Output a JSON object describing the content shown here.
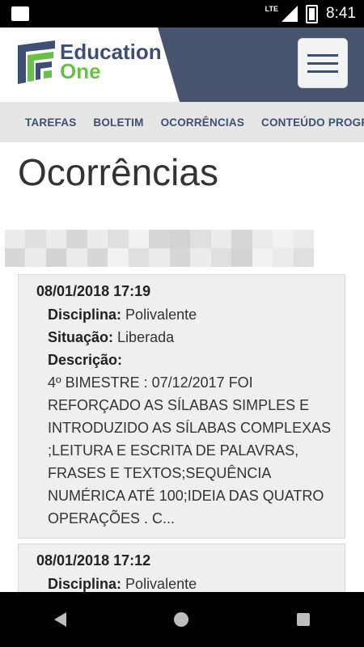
{
  "status_bar": {
    "network": "LTE",
    "time": "8:41"
  },
  "header": {
    "logo_line1": "Education",
    "logo_line2": "One"
  },
  "nav": {
    "tabs": [
      "TAREFAS",
      "BOLETIM",
      "OCORRÊNCIAS",
      "CONTEÚDO PROGR"
    ]
  },
  "page": {
    "title": "Ocorrências"
  },
  "entries": [
    {
      "datetime": "08/01/2018 17:19",
      "disciplina_label": "Disciplina:",
      "disciplina": "Polivalente",
      "situacao_label": "Situação:",
      "situacao": "Liberada",
      "descricao_label": "Descrição:",
      "descricao": "4º BIMESTRE : 07/12/2017 FOI REFORÇADO AS SÍLABAS SIMPLES E INTRODUZIDO AS SÍLABAS COMPLEXAS ;LEITURA E ESCRITA DE PALAVRAS, FRASES E TEXTOS;SEQUÊNCIA NUMÉRICA ATÉ 100;IDEIA DAS QUATRO OPERAÇÕES . C..."
    },
    {
      "datetime": "08/01/2018 17:12",
      "disciplina_label": "Disciplina:",
      "disciplina": "Polivalente"
    }
  ],
  "colors": {
    "brand_navy": "#3e4f75",
    "brand_green": "#6cbf4b",
    "header_bg": "#48546f"
  }
}
